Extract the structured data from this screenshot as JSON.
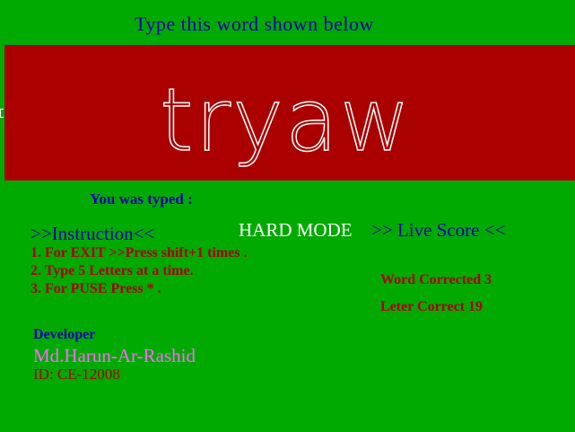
{
  "header": {
    "prompt": "Type this word shown below"
  },
  "word_display": {
    "target_word": "tryaw"
  },
  "typed": {
    "label": "You was typed :",
    "value": ""
  },
  "instructions": {
    "title": ">>Instruction<<",
    "items": [
      "1. For EXIT >>Press shift+1 times .",
      "2. Type 5 Letters at a time.",
      "3. For PUSE Press * ."
    ]
  },
  "mode": {
    "label": "HARD MODE"
  },
  "score": {
    "title": ">> Live Score <<",
    "words_corrected": "Word Corrected 3",
    "letters_correct": "Leter Correct 19"
  },
  "developer": {
    "label": "Developer",
    "name": "Md.Harun-Ar-Rashid",
    "id": "ID: CE-12008"
  },
  "colors": {
    "background": "#00aa00",
    "word_band": "#aa0000",
    "blue_text": "#0000aa",
    "red_text": "#aa0000",
    "white_text": "#ffffff",
    "magenta_text": "#ff66ff"
  }
}
